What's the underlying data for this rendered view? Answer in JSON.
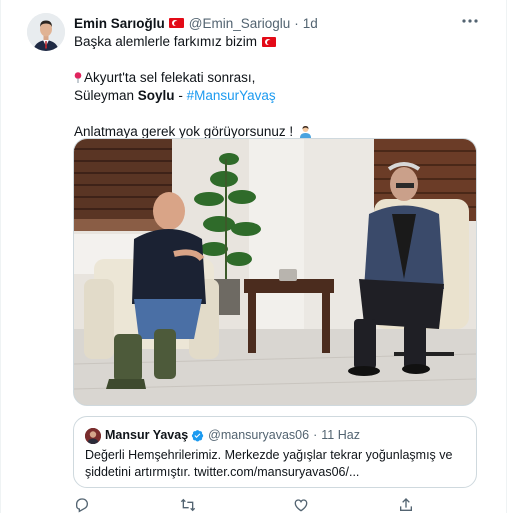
{
  "tweet": {
    "author_name": "Emin Sarıoğlu",
    "handle": "@Emin_Sarioglu",
    "separator": "·",
    "time": "1d",
    "lines": {
      "l1": "Başka alemlerle farkımız bizim",
      "l2": "Akyurt'ta sel felekati sonrası,",
      "l3_a": "Süleyman ",
      "l3_b": "Soylu",
      "l3_c": " - ",
      "l3_hashtag": "#MansurYavaş",
      "l4": "Anlatmaya gerek yok görüyorsunuz !"
    }
  },
  "quoted": {
    "author_name": "Mansur Yavaş",
    "handle": "@mansuryavas06",
    "separator": "·",
    "time": "11 Haz",
    "line1": "Değerli Hemşehrilerimiz. Merkezde yağışlar tekrar yoğunlaşmış ve",
    "line2": "şiddetini artırmıştır. twitter.com/mansuryavas06/..."
  },
  "icons": {
    "more": "more-dots-icon",
    "reply": "reply-icon",
    "retweet": "retweet-icon",
    "like": "like-icon",
    "share": "share-icon"
  },
  "colors": {
    "link": "#1d9bf0",
    "secondary_text": "#536471",
    "border": "#cfd9de",
    "flag_red": "#e30a17",
    "verified": "#1d9bf0"
  }
}
